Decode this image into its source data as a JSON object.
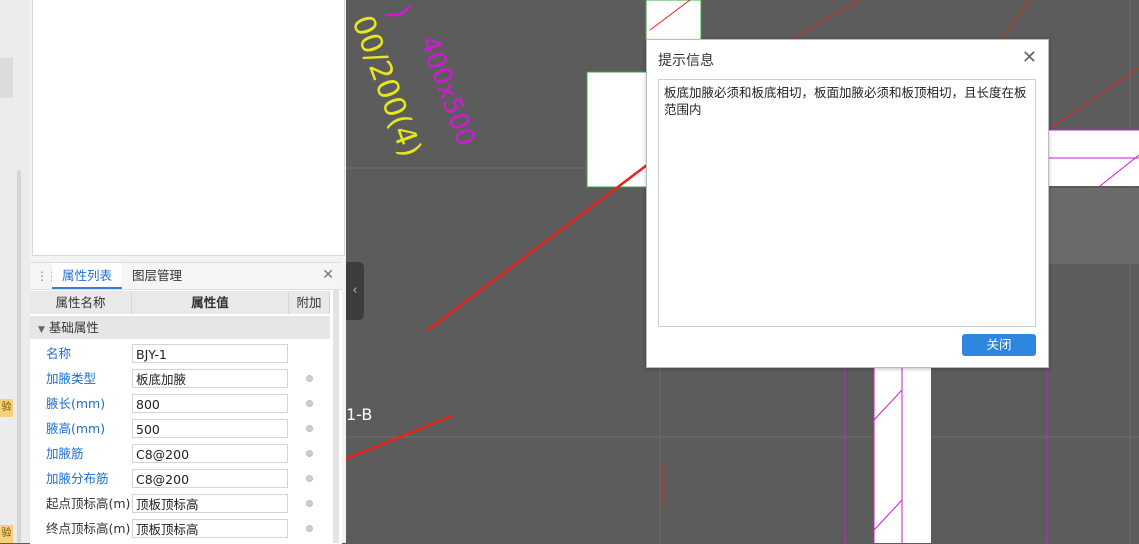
{
  "dialog": {
    "title": "提示信息",
    "message": "板底加腋必须和板底相切，板面加腋必须和板顶相切，且长度在板范围内",
    "close_button": "关闭"
  },
  "panel": {
    "tabs": [
      "属性列表",
      "图层管理"
    ],
    "columns": [
      "属性名称",
      "属性值",
      "附加"
    ],
    "group": "基础属性",
    "rows": [
      {
        "name": "名称",
        "value": "BJY-1"
      },
      {
        "name": "加腋类型",
        "value": "板底加腋"
      },
      {
        "name": "腋长(mm)",
        "value": "800"
      },
      {
        "name": "腋高(mm)",
        "value": "500"
      },
      {
        "name": "加腋筋",
        "value": "C8@200"
      },
      {
        "name": "加腋分布筋",
        "value": "C8@200"
      },
      {
        "name": "起点顶标高(m)",
        "value": "顶板顶标高"
      },
      {
        "name": "终点顶标高(m)",
        "value": "顶板顶标高"
      }
    ]
  },
  "side_tags": [
    "验",
    "验"
  ],
  "canvas_labels": {
    "yellow_top": "00/200(4)",
    "yellow_mid": "00/200(4)",
    "magenta": "400x500",
    "axis": "1-B"
  },
  "colors": {
    "accent": "#2e86e0",
    "canvas": "#5c5c5c",
    "arrow": "#e8231b",
    "magenta": "#d01ad6",
    "yellow": "#e6e61e"
  }
}
